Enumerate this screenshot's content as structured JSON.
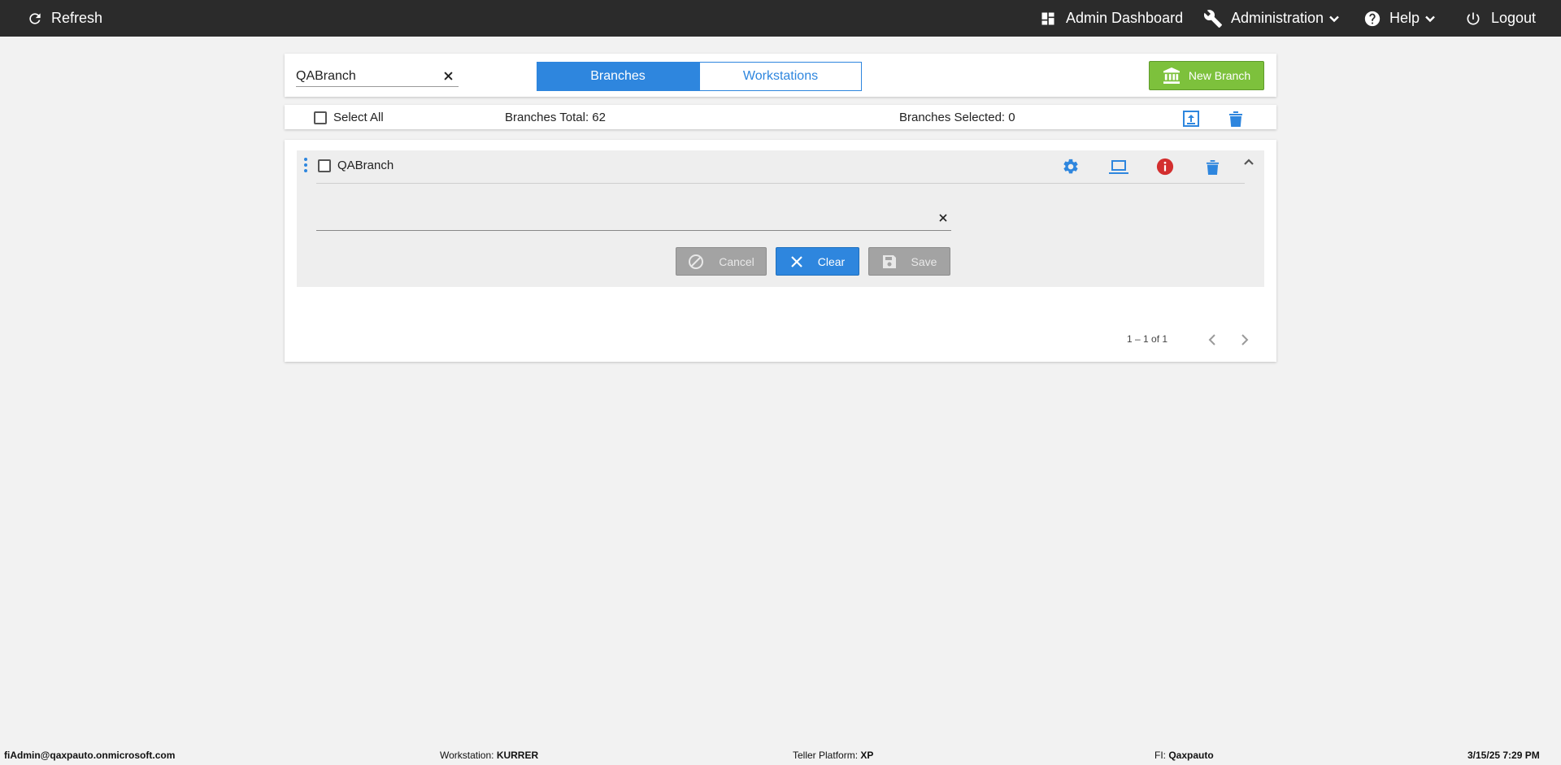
{
  "topbar": {
    "refresh_label": "Refresh",
    "admin_dashboard_label": "Admin Dashboard",
    "administration_label": "Administration",
    "help_label": "Help",
    "logout_label": "Logout",
    "background_color": "#2b2b2b"
  },
  "search": {
    "value": "QABranch",
    "placeholder": ""
  },
  "tabs": [
    {
      "label": "Branches",
      "active": true
    },
    {
      "label": "Workstations",
      "active": false
    }
  ],
  "new_branch_label": "New Branch",
  "summary": {
    "select_all_label": "Select All",
    "total_label": "Branches Total: 62",
    "selected_label": "Branches Selected: 0"
  },
  "branch_row": {
    "name": "QABranch",
    "checked": false,
    "expanded": true,
    "edit_value": ""
  },
  "actions": {
    "cancel_label": "Cancel",
    "clear_label": "Clear",
    "save_label": "Save"
  },
  "pagination": {
    "range_label": "1 – 1 of 1"
  },
  "footer": {
    "user": "fiAdmin@qaxpauto.onmicrosoft.com",
    "workstation_label": "Workstation:",
    "workstation_value": "KURRER",
    "teller_platform_label": "Teller Platform:",
    "teller_platform_value": "XP",
    "fi_label": "FI:",
    "fi_value": "Qaxpauto",
    "datetime": "3/15/25 7:29 PM"
  },
  "colors": {
    "accent": "#2e86de",
    "new_branch": "#7dc13c",
    "info": "#d32f2f",
    "disabled_button": "#a3a3a3"
  }
}
